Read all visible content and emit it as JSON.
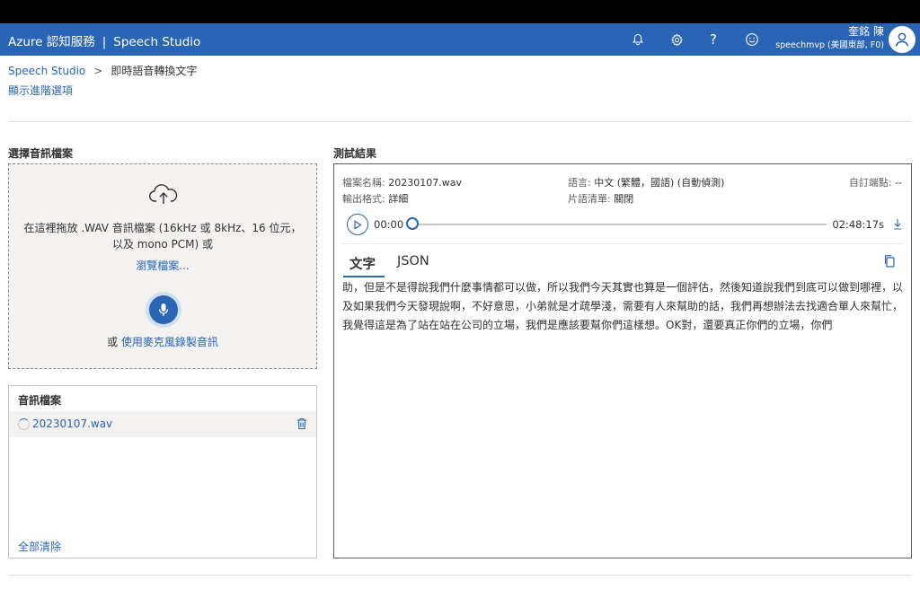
{
  "header": {
    "brand": "Azure 認知服務",
    "separator": "|",
    "product": "Speech Studio",
    "user_name": "奎銘 陳",
    "user_resource": "speechmvp (美國東部, F0)",
    "icons": [
      "bell-icon",
      "gear-icon",
      "help-icon",
      "smile-icon",
      "person-icon"
    ]
  },
  "breadcrumb": {
    "root": "Speech Studio",
    "current": "即時語音轉換文字"
  },
  "advanced_link": "顯示進階選項",
  "left": {
    "select_title": "選擇音訊檔案",
    "drop_line1": "在這裡拖放 .WAV 音訊檔案 (16kHz 或 8kHz、16 位元，",
    "drop_line2": "以及 mono PCM) 或",
    "browse": "瀏覽檔案...",
    "or_prefix": "或",
    "record_link": "使用麥克風錄製音訊",
    "files_title": "音訊檔案",
    "files": [
      {
        "name": "20230107.wav"
      }
    ],
    "clear_all": "全部清除"
  },
  "results": {
    "title": "測試結果",
    "file_label": "檔案名稱:",
    "file_value": "20230107.wav",
    "output_label": "輸出格式:",
    "output_value": "詳細",
    "lang_label": "語言:",
    "lang_value": "中文 (繁體，國語) (自動偵測)",
    "phrase_label": "片語清單:",
    "phrase_value": "關閉",
    "endpoint_label": "自訂端點:",
    "endpoint_value": "--",
    "time_current": "00:00",
    "time_total": "02:48:17s",
    "progress": 0,
    "tabs": [
      "文字",
      "JSON"
    ],
    "active_tab": "文字",
    "transcript": "助，但是不是得說我們什麼事情都可以做，所以我們今天其實也算是一個評估，然後知道說我們到底可以做到哪裡，以及如果我們今天發現說啊，不好意思，小弟就是才疏學淺，需要有人來幫助的話，我們再想辦法去找適合單人來幫忙，我覺得這是為了站在站在公司的立場，我們是應該要幫你們這樣想。OK對，還要真正你們的立場，你們"
  },
  "colors": {
    "accent": "#2a64b4",
    "appbar": "#2a64b4",
    "panel_bg": "#f3f2f1"
  }
}
